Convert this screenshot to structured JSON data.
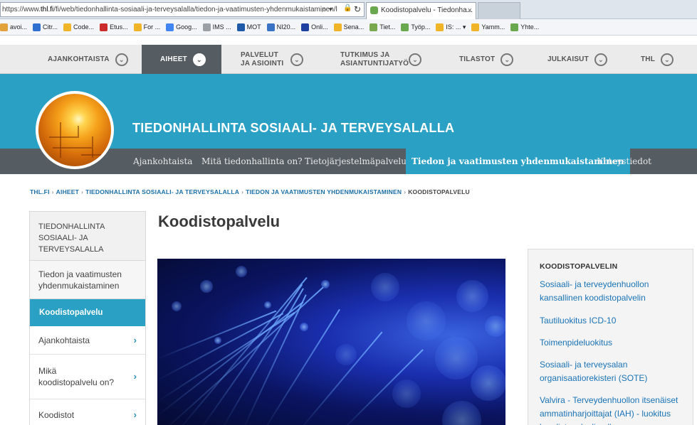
{
  "browser": {
    "url_prefix": "https://www.",
    "url_domain": "thl.fi",
    "url_path": "/fi/web/tiedonhallinta-sosiaali-ja-terveysalalla/tiedon-ja-vaatimusten-yhdenmukaistaminen/l",
    "tab_title": "Koodistopalvelu - Tiedonha...",
    "tab_close": "×",
    "search_glyph": "⌕ ▾",
    "lock_glyph": "🔒",
    "reload_glyph": "↻",
    "favorites": [
      {
        "label": "avoi...",
        "color": "#e2a23b"
      },
      {
        "label": "Citr...",
        "color": "#2f6fd0"
      },
      {
        "label": "Code...",
        "color": "#f0b429"
      },
      {
        "label": "Etus...",
        "color": "#cc2b2b"
      },
      {
        "label": "For ...",
        "color": "#f0b429"
      },
      {
        "label": "Goog...",
        "color": "#4285f4"
      },
      {
        "label": "IMS ...",
        "color": "#9aa0a6"
      },
      {
        "label": "MOT",
        "color": "#1f5aa8"
      },
      {
        "label": "NI20...",
        "color": "#3b73c4"
      },
      {
        "label": "Onli...",
        "color": "#1e40a0"
      },
      {
        "label": "Sena...",
        "color": "#f0b429"
      },
      {
        "label": "Tiet...",
        "color": "#7aa84f"
      },
      {
        "label": "Työp...",
        "color": "#6aa84f"
      },
      {
        "label": "IS: ... ▾",
        "color": "#f0b429"
      },
      {
        "label": "Yamm...",
        "color": "#f0b429"
      },
      {
        "label": "Yhte...",
        "color": "#6aa84f"
      }
    ]
  },
  "topnav": {
    "items": [
      {
        "label": "AJANKOHTAISTA"
      },
      {
        "label": "AIHEET"
      },
      {
        "label": "PALVELUT JA ASIOINTI"
      },
      {
        "label": "TUTKIMUS JA ASIANTUNTIJATYÖ"
      },
      {
        "label": "TILASTOT"
      },
      {
        "label": "JULKAISUT"
      },
      {
        "label": "THL"
      }
    ],
    "chevron": "⌄"
  },
  "site": {
    "title": "TIEDONHALLINTA SOSIAALI- JA TERVEYSALALLA"
  },
  "subnav": {
    "items": [
      {
        "label": "Ajankohtaista"
      },
      {
        "label": "Mitä tiedonhallinta on?"
      },
      {
        "label": "Tietojärjestelmäpalvelut"
      },
      {
        "label": "Tiedon ja vaatimusten yhdenmukaistaminen"
      },
      {
        "label": "Yhteystiedot"
      }
    ]
  },
  "breadcrumb": {
    "items": [
      "THL.FI",
      "AIHEET",
      "TIEDONHALLINTA SOSIAALI- JA TERVEYSALALLA",
      "TIEDON JA VAATIMUSTEN YHDENMUKAISTAMINEN",
      "KOODISTOPALVELU"
    ],
    "separator": "›"
  },
  "sidebar": {
    "head": "TIEDONHALLINTA SOSIAALI- JA TERVEYSALALLA",
    "parent": "Tiedon ja vaatimusten yhdenmukaistaminen",
    "active": "Koodistopalvelu",
    "items": [
      {
        "label": "Ajankohtaista"
      },
      {
        "label": "Mikä koodistopalvelu on?"
      },
      {
        "label": "Koodistot"
      }
    ],
    "arrow": "›"
  },
  "main": {
    "title": "Koodistopalvelu"
  },
  "rightbox": {
    "heading": "KOODISTOPALVELIN",
    "links": [
      "Sosiaali- ja terveydenhuollon kansallinen koodistopalvelin",
      "Tautiluokitus ICD-10",
      "Toimenpideluokitus",
      "Sosiaali- ja terveysalan organisaatiorekisteri (SOTE)",
      "Valvira - Terveydenhuollon itsenäiset ammatinharjoittajat (IAH) - luokitus koodistopalvelimella"
    ]
  }
}
